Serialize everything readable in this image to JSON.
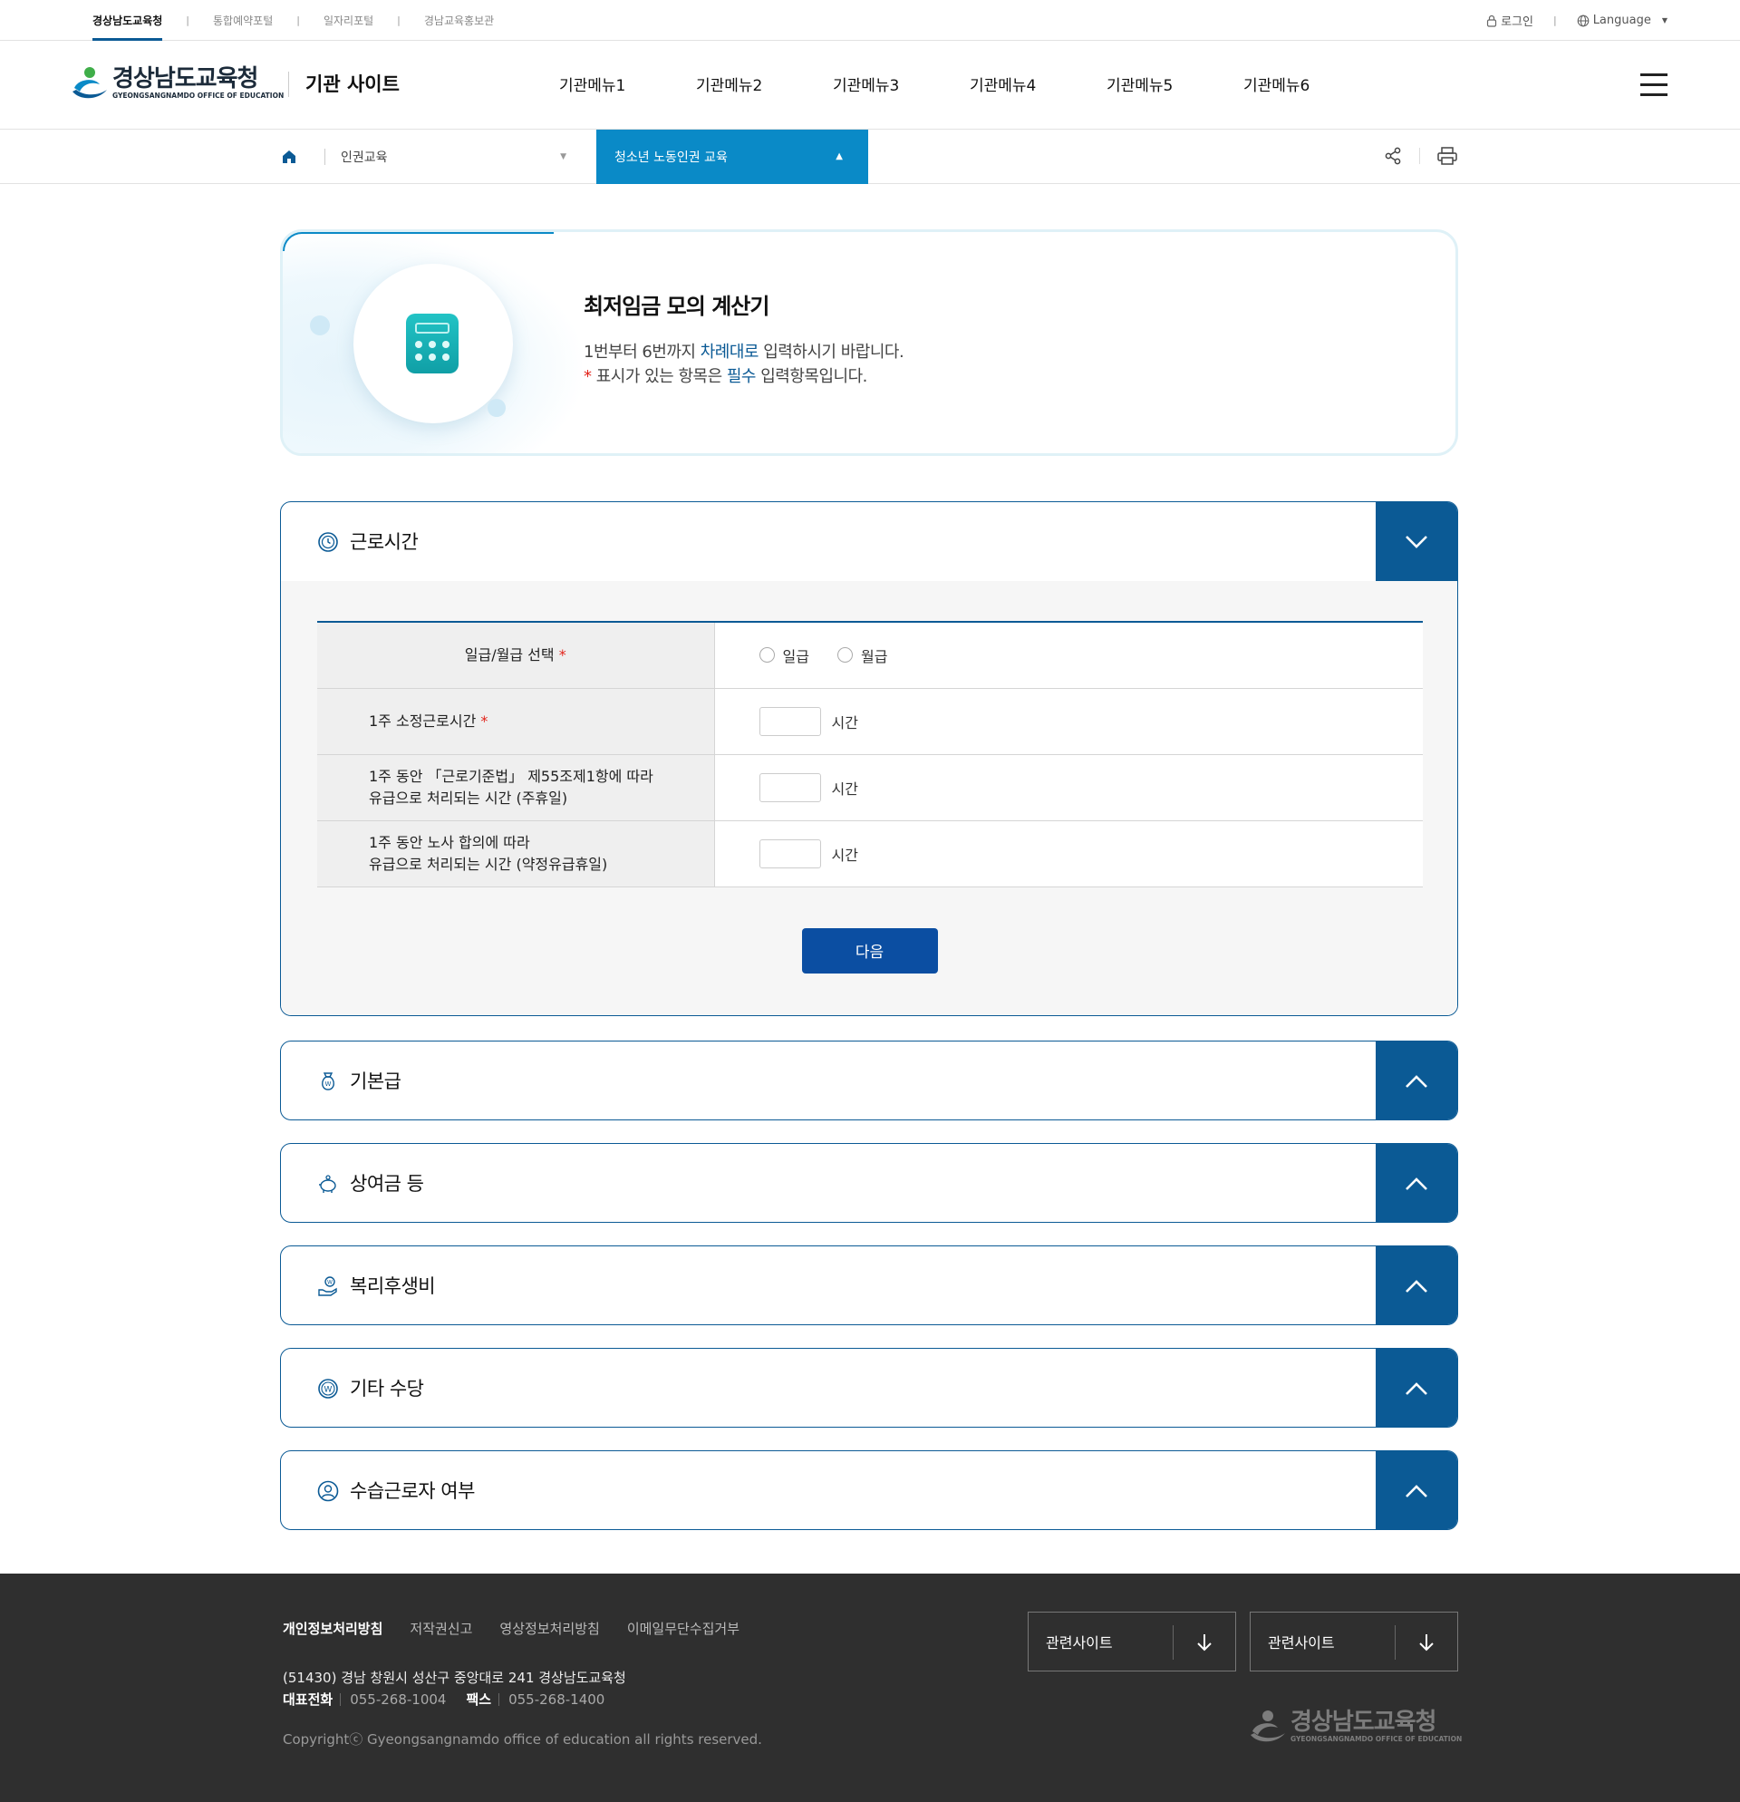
{
  "topbar": {
    "family_sites": [
      "경상남도교육청",
      "통합예약포털",
      "일자리포털",
      "경남교육홍보관"
    ],
    "login": "로그인",
    "language": "Language"
  },
  "header": {
    "logo_ko": "경상남도교육청",
    "logo_en": "GYEONGSANGNAMDO OFFICE OF EDUCATION",
    "site_name": "기관 사이트",
    "menu": [
      "기관메뉴1",
      "기관메뉴2",
      "기관메뉴3",
      "기관메뉴4",
      "기관메뉴5",
      "기관메뉴6"
    ]
  },
  "location": {
    "depth1": "인권교육",
    "depth2": "청소년 노동인권 교육"
  },
  "intro": {
    "title": "최저임금 모의 계산기",
    "line1_pre": "1번부터 6번까지 ",
    "line1_hl": "차례대로",
    "line1_post": " 입력하시기 바랍니다.",
    "line2_mark": "*",
    "line2_pre": " 표시가 있는 항목은 ",
    "line2_hl": "필수",
    "line2_post": " 입력항목입니다."
  },
  "sections": [
    {
      "title": "근로시간",
      "icon": "clock-icon",
      "expanded": true
    },
    {
      "title": "기본급",
      "icon": "money-bag-icon",
      "expanded": false
    },
    {
      "title": "상여금 등",
      "icon": "piggy-bank-icon",
      "expanded": false
    },
    {
      "title": "복리후생비",
      "icon": "hand-coin-icon",
      "expanded": false
    },
    {
      "title": "기타 수당",
      "icon": "won-coin-icon",
      "expanded": false
    },
    {
      "title": "수습근로자 여부",
      "icon": "user-icon",
      "expanded": false
    }
  ],
  "work_hours_form": {
    "pay_type_label": "일급/월급 선택",
    "pay_type_options": [
      "일급",
      "월급"
    ],
    "weekly_hours_label": "1주 소정근로시간",
    "holiday_label_1": "1주 동안 「근로기준법」 제55조제1항에 따라",
    "holiday_label_2": "유급으로 처리되는 시간 (주휴일)",
    "agreed_label_1": "1주 동안 노사 합의에 따라",
    "agreed_label_2": "유급으로 처리되는 시간 (약정유급휴일)",
    "unit": "시간",
    "required_mark": "*",
    "next_button": "다음"
  },
  "footer": {
    "links": [
      "개인정보처리방침",
      "저작권신고",
      "영상정보처리방침",
      "이메일무단수집거부"
    ],
    "address": "(51430) 경남 창원시 성산구 중앙대로 241 경상남도교육청",
    "tel_label": "대표전화",
    "tel": "055-268-1004",
    "fax_label": "팩스",
    "fax": "055-268-1400",
    "copyright": "Copyrightⓒ Gyeongsangnamdo office of education all rights reserved.",
    "related_sites": [
      "관련사이트",
      "관련사이트"
    ],
    "logo_ko": "경상남도교육청",
    "logo_en": "GYEONGSANGNAMDO OFFICE OF EDUCATION"
  },
  "colors": {
    "primary_navy": "#0b5a95",
    "accent_cyan": "#0a8ac7",
    "button_blue": "#0b4ea2",
    "required_red": "#e2231a",
    "footer_bg": "#2f2f2f"
  }
}
